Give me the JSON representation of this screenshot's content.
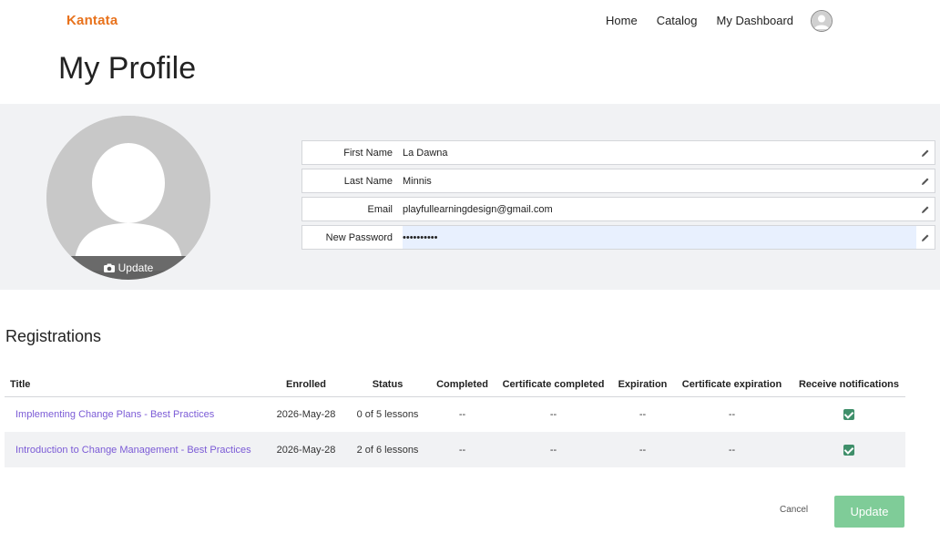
{
  "header": {
    "brand": "Kantata",
    "nav": [
      {
        "label": "Home"
      },
      {
        "label": "Catalog"
      },
      {
        "label": "My Dashboard"
      }
    ]
  },
  "page": {
    "title": "My Profile"
  },
  "profile": {
    "avatar_update_label": "Update",
    "fields": [
      {
        "label": "First Name",
        "value": "La Dawna"
      },
      {
        "label": "Last Name",
        "value": "Minnis"
      },
      {
        "label": "Email",
        "value": "playfullearningdesign@gmail.com"
      },
      {
        "label": "New Password",
        "value": "••••••••••"
      }
    ]
  },
  "registrations": {
    "title": "Registrations",
    "columns": [
      "Title",
      "Enrolled",
      "Status",
      "Completed",
      "Certificate completed",
      "Expiration",
      "Certificate expiration",
      "Receive notifications"
    ],
    "rows": [
      {
        "title": "Implementing Change Plans - Best Practices",
        "enrolled": "2026-May-28",
        "status": "0 of 5 lessons",
        "completed": "--",
        "certificate_completed": "--",
        "expiration": "--",
        "certificate_expiration": "--",
        "receive_notifications": true
      },
      {
        "title": "Introduction to Change Management - Best Practices",
        "enrolled": "2026-May-28",
        "status": "2 of 6 lessons",
        "completed": "--",
        "certificate_completed": "--",
        "expiration": "--",
        "certificate_expiration": "--",
        "receive_notifications": true
      }
    ]
  },
  "actions": {
    "cancel_label": "Cancel",
    "update_label": "Update"
  },
  "colors": {
    "brand": "#e8721c",
    "link": "#7b5bd6",
    "update_button": "#7fcc98",
    "checkbox": "#3f8f6a"
  }
}
